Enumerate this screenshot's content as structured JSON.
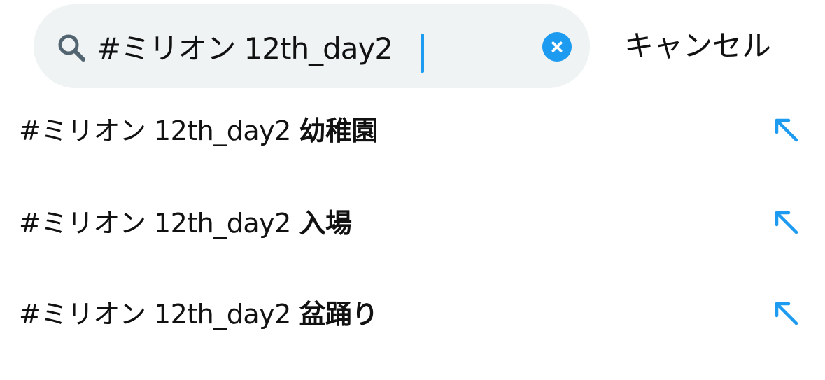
{
  "search": {
    "query": "#ミリオン 12th_day2",
    "icon": "search-icon",
    "clear_icon": "clear-icon",
    "accent_color": "#1d9bf0",
    "background_color": "#eff3f4"
  },
  "cancel_label": "キャンセル",
  "suggestions": [
    {
      "prefix": "#ミリオン 12th_day2",
      "suffix": "幼稚園",
      "icon": "arrow-up-left-icon"
    },
    {
      "prefix": "#ミリオン 12th_day2",
      "suffix": "入場",
      "icon": "arrow-up-left-icon"
    },
    {
      "prefix": "#ミリオン 12th_day2",
      "suffix": "盆踊り",
      "icon": "arrow-up-left-icon"
    }
  ]
}
